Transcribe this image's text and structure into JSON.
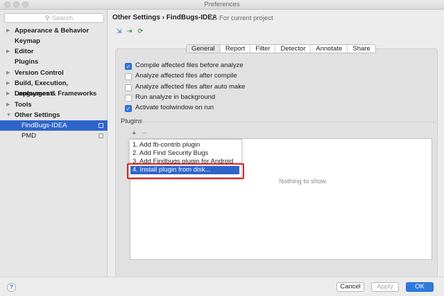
{
  "window": {
    "title": "Preferences"
  },
  "sidebar": {
    "search_placeholder": "Search",
    "items": [
      {
        "label": "Appearance & Behavior",
        "expandable": true
      },
      {
        "label": "Keymap",
        "expandable": false
      },
      {
        "label": "Editor",
        "expandable": true
      },
      {
        "label": "Plugins",
        "expandable": false
      },
      {
        "label": "Version Control",
        "expandable": true
      },
      {
        "label": "Build, Execution, Deployment",
        "expandable": true
      },
      {
        "label": "Languages & Frameworks",
        "expandable": true
      },
      {
        "label": "Tools",
        "expandable": true
      },
      {
        "label": "Other Settings",
        "expandable": true,
        "expanded": true
      },
      {
        "label": "FindBugs-IDEA",
        "child": true,
        "selected": true
      },
      {
        "label": "PMD",
        "child": true
      }
    ]
  },
  "header": {
    "breadcrumb": "Other Settings › FindBugs-IDEA",
    "scope": "For current project"
  },
  "tabs": [
    "General",
    "Report",
    "Filter",
    "Detector",
    "Annotate",
    "Share"
  ],
  "active_tab": "General",
  "options": [
    {
      "label": "Compile affected files before analyze",
      "checked": true
    },
    {
      "label": "Analyze affected files after compile",
      "checked": false
    },
    {
      "label": "Analyze affected files after auto make",
      "checked": false
    },
    {
      "label": "Run analyze in background",
      "checked": false
    },
    {
      "label": "Activate toolwindow on run",
      "checked": true
    }
  ],
  "plugins": {
    "label": "Plugins",
    "add": "+",
    "remove": "−",
    "empty_text": "Nothing to show",
    "menu": [
      "1. Add fb-contrib plugin",
      "2. Add Find Security Bugs",
      "3. Add Findbugs plugin for Android",
      "4. Install plugin from disk..."
    ],
    "highlighted_index": 3
  },
  "footer": {
    "help": "?",
    "cancel": "Cancel",
    "apply": "Apply",
    "ok": "OK"
  },
  "colors": {
    "selection": "#2f65ca",
    "primary": "#2f7ae0",
    "highlight_box": "#e31f1f"
  }
}
